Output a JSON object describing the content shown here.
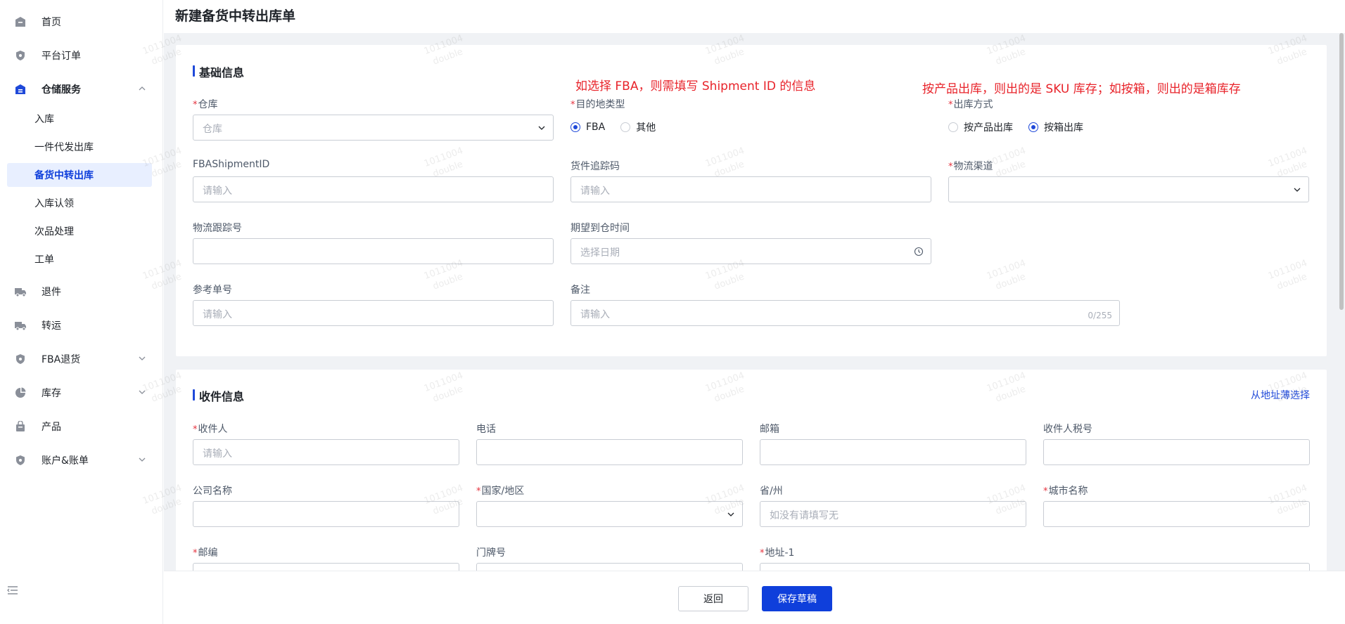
{
  "sidebar": {
    "items": [
      {
        "label": "首页",
        "icon": "home-icon"
      },
      {
        "label": "平台订单",
        "icon": "shield-icon"
      },
      {
        "label": "仓储服务",
        "icon": "warehouse-icon"
      },
      {
        "label": "退件",
        "icon": "truck-icon"
      },
      {
        "label": "转运",
        "icon": "truck-icon"
      },
      {
        "label": "FBA退货",
        "icon": "shield-icon"
      },
      {
        "label": "库存",
        "icon": "pie-chart-icon"
      },
      {
        "label": "产品",
        "icon": "bag-icon"
      },
      {
        "label": "账户&账单",
        "icon": "shield-icon"
      }
    ],
    "sub_items": [
      "入库",
      "一件代发出库",
      "备货中转出库",
      "入库认领",
      "次品处理",
      "工单"
    ],
    "active_sub": "备货中转出库"
  },
  "page": {
    "title": "新建备货中转出库单"
  },
  "basic": {
    "title": "基础信息",
    "annotation_1": "如选择 FBA，则需填写 Shipment ID 的信息",
    "annotation_2": "按产品出库，则出的是 SKU 库存；如按箱，则出的是箱库存",
    "warehouse": {
      "label": "仓库",
      "placeholder": "仓库"
    },
    "dest_type": {
      "label": "目的地类型",
      "options": [
        "FBA",
        "其他"
      ],
      "selected": "FBA"
    },
    "outbound_mode": {
      "label": "出库方式",
      "options": [
        "按产品出库",
        "按箱出库"
      ],
      "selected": "按箱出库"
    },
    "fba_shipment_id": {
      "label": "FBAShipmentID",
      "placeholder": "请输入"
    },
    "cargo_tracking": {
      "label": "货件追踪码",
      "placeholder": "请输入"
    },
    "logistics_channel": {
      "label": "物流渠道",
      "placeholder": ""
    },
    "logistics_tracking": {
      "label": "物流跟踪号",
      "placeholder": ""
    },
    "expected_arrival": {
      "label": "期望到仓时间",
      "placeholder": "选择日期"
    },
    "reference_no": {
      "label": "参考单号",
      "placeholder": "请输入"
    },
    "remark": {
      "label": "备注",
      "placeholder": "请输入",
      "counter": "0/255"
    }
  },
  "recipient": {
    "title": "收件信息",
    "address_book_link": "从地址薄选择",
    "name": {
      "label": "收件人",
      "placeholder": "请输入"
    },
    "phone": {
      "label": "电话",
      "placeholder": ""
    },
    "email": {
      "label": "邮箱",
      "placeholder": ""
    },
    "tax_id": {
      "label": "收件人税号",
      "placeholder": ""
    },
    "company": {
      "label": "公司名称",
      "placeholder": ""
    },
    "country": {
      "label": "国家/地区",
      "placeholder": ""
    },
    "province": {
      "label": "省/州",
      "placeholder": "如没有请填写无"
    },
    "city": {
      "label": "城市名称",
      "placeholder": ""
    },
    "zip": {
      "label": "邮编"
    },
    "house_no": {
      "label": "门牌号"
    },
    "address1": {
      "label": "地址-1"
    }
  },
  "footer": {
    "back_label": "返回",
    "save_label": "保存草稿"
  },
  "colors": {
    "primary": "#0f3fdb",
    "required": "#e5323e",
    "annotation": "#e8232a"
  }
}
